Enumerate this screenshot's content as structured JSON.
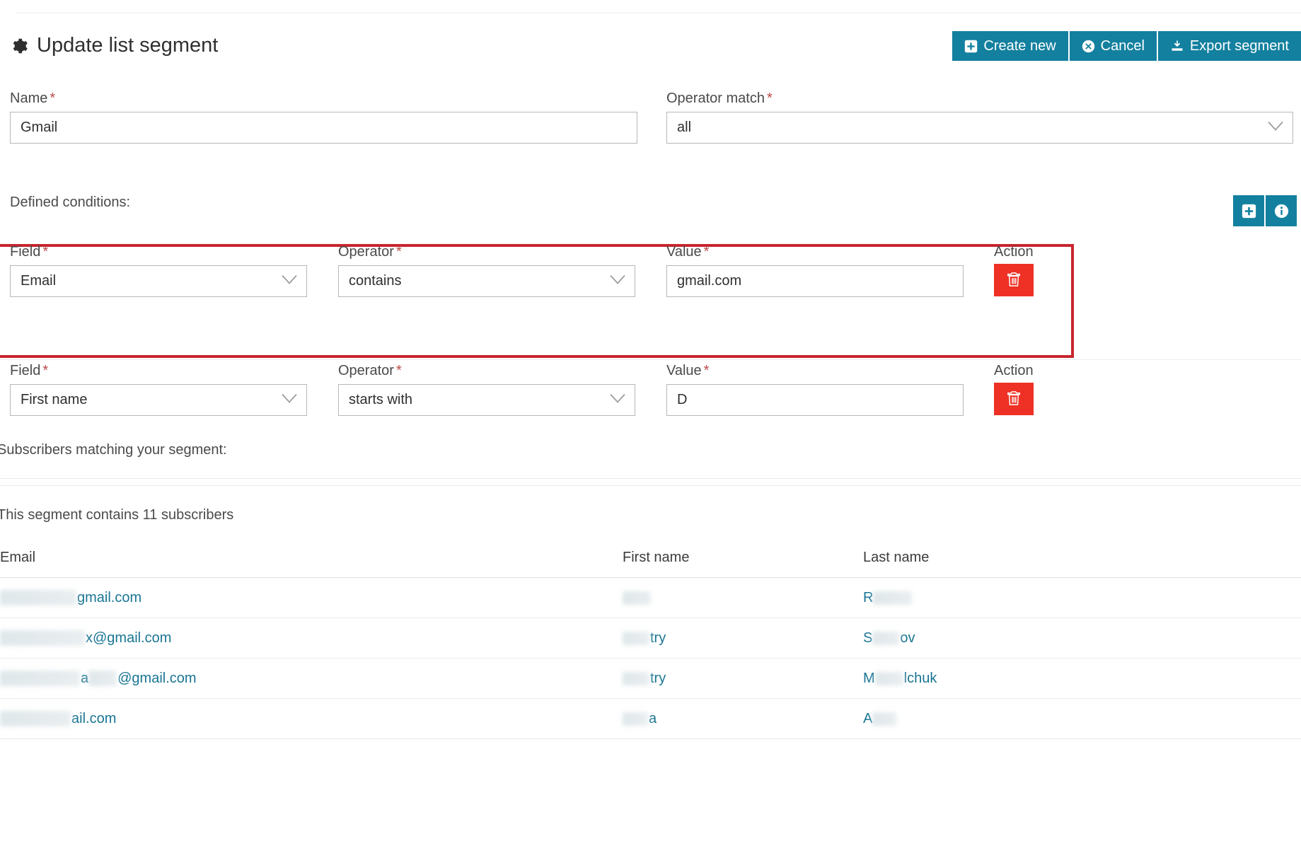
{
  "header": {
    "title": "Update list segment",
    "gear_icon": "gear-icon",
    "buttons": [
      {
        "label": "Create new",
        "icon": "plus-square-icon"
      },
      {
        "label": "Cancel",
        "icon": "times-circle-icon"
      },
      {
        "label": "Export segment",
        "icon": "export-icon"
      }
    ]
  },
  "form": {
    "name": {
      "label": "Name",
      "required": "*",
      "value": "Gmail"
    },
    "operator_match": {
      "label": "Operator match",
      "required": "*",
      "value": "all"
    }
  },
  "conditions": {
    "section_label": "Defined conditions:",
    "add_button_icon": "plus-square-icon",
    "info_button_icon": "info-circle-icon",
    "labels": {
      "field": "Field",
      "operator": "Operator",
      "value": "Value",
      "action": "Action",
      "required": "*"
    },
    "rows": [
      {
        "field": "Email",
        "operator": "contains",
        "value": "gmail.com",
        "delete_icon": "trash-icon",
        "highlighted": true
      },
      {
        "field": "First name",
        "operator": "starts with",
        "value": "D",
        "delete_icon": "trash-icon",
        "highlighted": false
      }
    ]
  },
  "subscribers": {
    "section_label": "Subscribers matching your segment:",
    "count_text": "This segment contains 11 subscribers",
    "columns": [
      "Email",
      "First name",
      "Last name"
    ],
    "rows": [
      {
        "email_redacted_width": 108,
        "email_suffix": "gmail.com",
        "first_redacted_width": 40,
        "first_suffix": "",
        "last_prefix": "R",
        "last_redacted_width": 55,
        "last_suffix": ""
      },
      {
        "email_redacted_width": 120,
        "email_suffix": "x@gmail.com",
        "first_redacted_width": 38,
        "first_suffix": "try",
        "last_prefix": "S",
        "last_redacted_width": 38,
        "last_suffix": "ov"
      },
      {
        "email_redacted_width": 113,
        "email_suffix": "a",
        "email_redacted2_width": 40,
        "email_suffix2": "@gmail.com",
        "first_redacted_width": 38,
        "first_suffix": "try",
        "last_prefix": "M",
        "last_redacted_width": 40,
        "last_suffix": "lchuk"
      },
      {
        "email_redacted_width": 100,
        "email_suffix": "ail.com",
        "first_redacted_width": 36,
        "first_suffix": "a",
        "last_prefix": "A",
        "last_redacted_width": 34,
        "last_suffix": ""
      }
    ]
  },
  "colors": {
    "teal": "#13809f",
    "red": "#ee3124",
    "highlight_border": "#c8252e",
    "link": "#1a7593",
    "required_asterisk": "#b94a48"
  }
}
